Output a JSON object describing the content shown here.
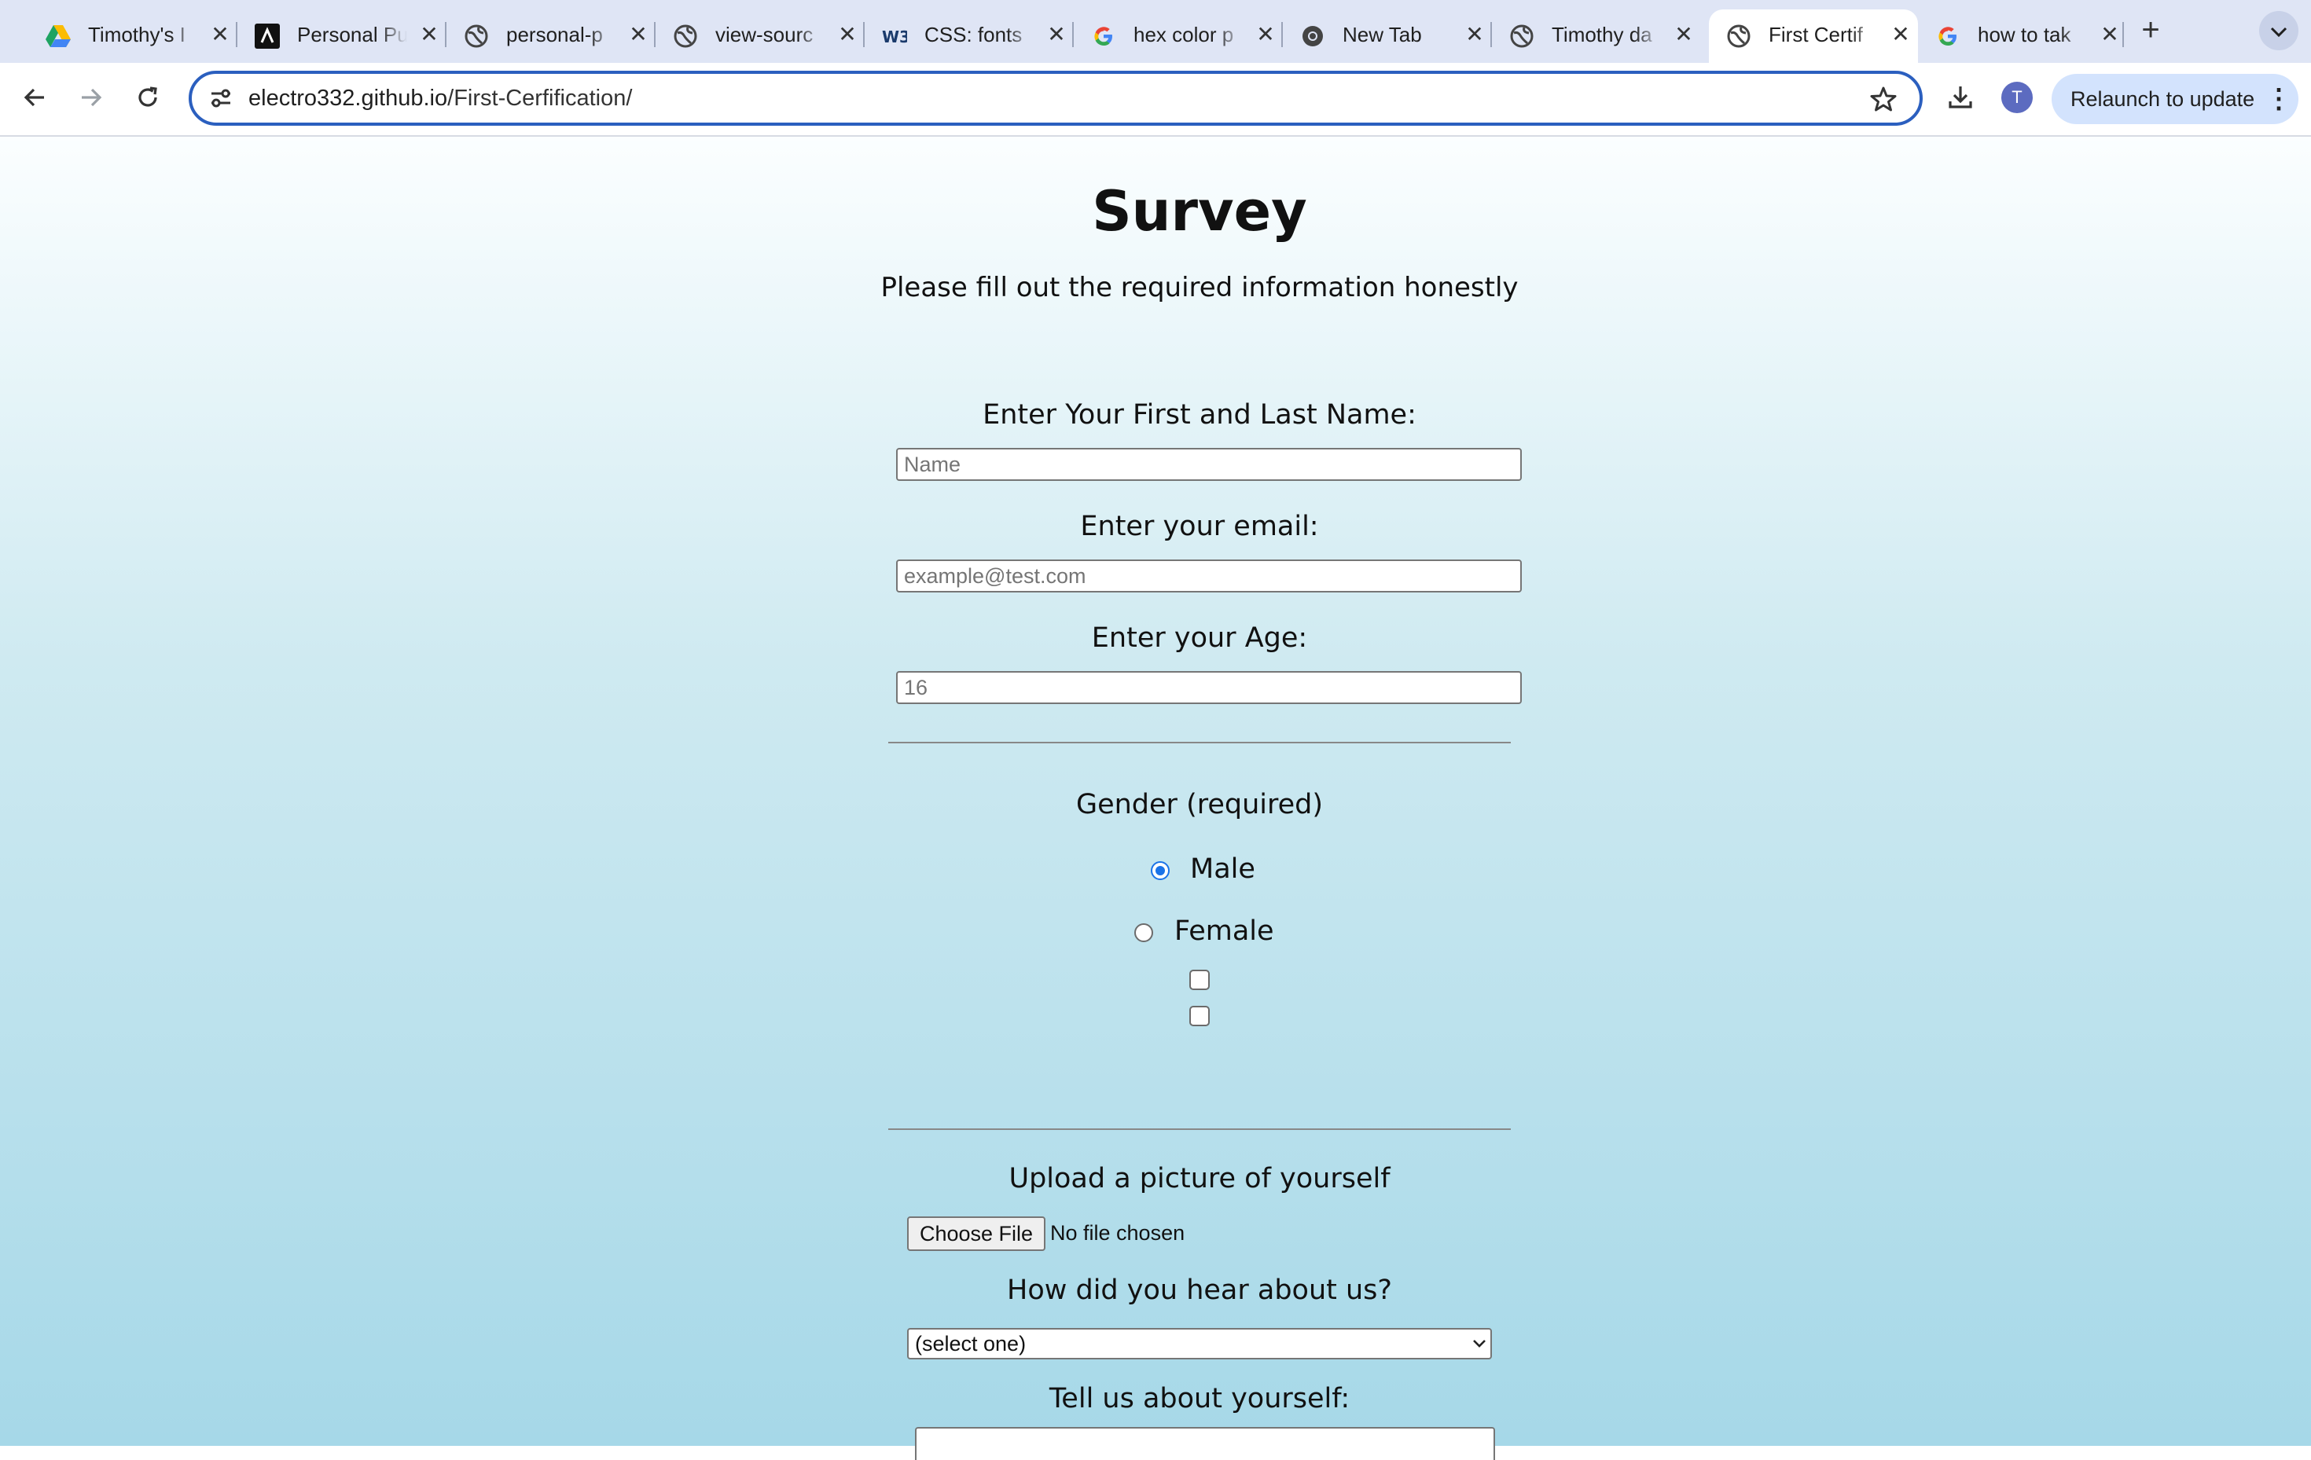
{
  "browser": {
    "tabs": [
      {
        "title": "Timothy's I",
        "icon": "google-drive-icon"
      },
      {
        "title": "Personal Pu",
        "icon": "portfolio-site-icon"
      },
      {
        "title": "personal-p",
        "icon": "globe-icon"
      },
      {
        "title": "view-sourc",
        "icon": "globe-icon"
      },
      {
        "title": "CSS: fonts",
        "icon": "w3schools-icon"
      },
      {
        "title": "hex color p",
        "icon": "google-icon"
      },
      {
        "title": "New Tab",
        "icon": "chrome-icon"
      },
      {
        "title": "Timothy da",
        "icon": "globe-icon"
      },
      {
        "title": "First Certif",
        "icon": "globe-icon",
        "active": true
      },
      {
        "title": "how to tak",
        "icon": "google-icon"
      }
    ],
    "new_tab_label": "+",
    "close_glyph": "✕",
    "url_host": "electro332.github.io",
    "url_path": "/First-Cerfification/",
    "profile_initial": "T",
    "relaunch_label": "Relaunch to update",
    "more_glyph": "⋮",
    "accent_color": "#2b5fbf"
  },
  "page": {
    "title": "Survey",
    "description": "Please fill out the required information honestly",
    "name_label": "Enter Your First and Last Name:",
    "name_placeholder": "Name",
    "email_label": "Enter your email:",
    "email_placeholder": "example@test.com",
    "age_label": "Enter your Age:",
    "age_placeholder": "16",
    "gender_label": "Gender (required)",
    "gender_options": [
      {
        "label": "Male",
        "checked": true
      },
      {
        "label": "Female",
        "checked": false
      }
    ],
    "checkboxes": [
      {
        "checked": false
      },
      {
        "checked": false
      }
    ],
    "upload_label": "Upload a picture of yourself",
    "file_button": "Choose File",
    "file_status": "No file chosen",
    "referral_label": "How did you hear about us?",
    "referral_selected": "(select one)",
    "about_label": "Tell us about yourself:",
    "radio_color": "#1a73e8"
  }
}
